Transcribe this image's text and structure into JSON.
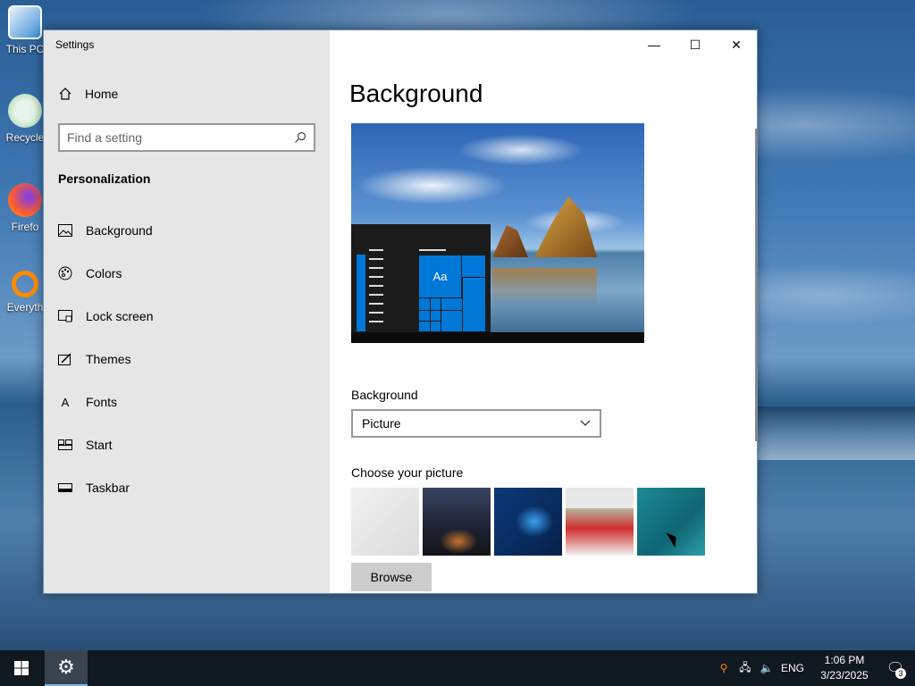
{
  "window": {
    "title": "Settings",
    "minimize_icon": "—",
    "maximize_icon": "☐",
    "close_icon": "✕"
  },
  "desktop": {
    "icons": [
      {
        "label": "This PC",
        "icon": "computer-icon"
      },
      {
        "label": "Recycle",
        "icon": "recycle-bin-icon"
      },
      {
        "label": "Firefo",
        "icon": "firefox-icon"
      },
      {
        "label": "Everyth",
        "icon": "everything-search-icon"
      }
    ]
  },
  "sidebar": {
    "home_label": "Home",
    "search_placeholder": "Find a setting",
    "section_title": "Personalization",
    "items": [
      {
        "label": "Background",
        "icon": "picture-icon"
      },
      {
        "label": "Colors",
        "icon": "palette-icon"
      },
      {
        "label": "Lock screen",
        "icon": "lock-screen-icon"
      },
      {
        "label": "Themes",
        "icon": "brush-icon"
      },
      {
        "label": "Fonts",
        "icon": "font-icon"
      },
      {
        "label": "Start",
        "icon": "start-icon"
      },
      {
        "label": "Taskbar",
        "icon": "taskbar-icon"
      }
    ]
  },
  "main": {
    "page_title": "Background",
    "preview_tile_text": "Aa",
    "background_label": "Background",
    "background_value": "Picture",
    "choose_picture_label": "Choose your picture",
    "browse_label": "Browse"
  },
  "taskbar": {
    "language": "ENG",
    "time": "1:06 PM",
    "date": "3/23/2025",
    "notification_count": "3"
  }
}
